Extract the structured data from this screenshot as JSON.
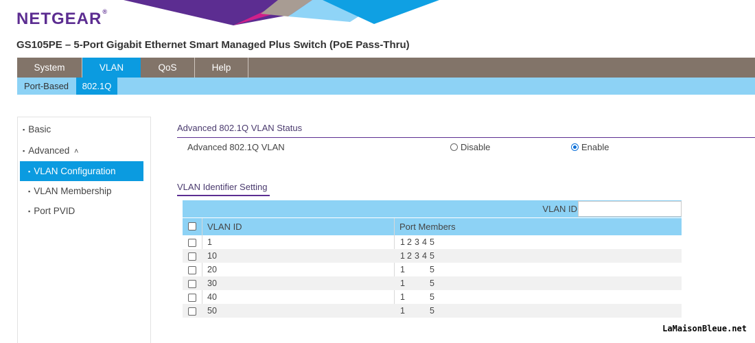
{
  "brand": {
    "logo_text": "NETGEAR",
    "logo_mark": "®"
  },
  "product_title": "GS105PE – 5-Port Gigabit Ethernet Smart Managed Plus Switch (PoE Pass-Thru)",
  "top_nav": {
    "tabs": [
      {
        "label": "System",
        "active": false
      },
      {
        "label": "VLAN",
        "active": true
      },
      {
        "label": "QoS",
        "active": false
      },
      {
        "label": "Help",
        "active": false
      }
    ]
  },
  "sub_nav": {
    "items": [
      {
        "label": "Port-Based",
        "active": false
      },
      {
        "label": "802.1Q",
        "active": true
      }
    ]
  },
  "sidebar": {
    "items": [
      {
        "label": "Basic",
        "bullet": "▪"
      },
      {
        "label": "Advanced",
        "bullet": "▪",
        "caret": "˄"
      },
      {
        "label": "VLAN Configuration",
        "bullet": "▪",
        "active": true
      },
      {
        "label": "VLAN Membership",
        "bullet": "▪"
      },
      {
        "label": "Port PVID",
        "bullet": "▪"
      }
    ]
  },
  "status_section": {
    "title": "Advanced 802.1Q VLAN Status",
    "row_label": "Advanced 802.1Q VLAN",
    "options": [
      {
        "label": "Disable",
        "checked": false
      },
      {
        "label": "Enable",
        "checked": true
      }
    ]
  },
  "identifier_section": {
    "title": "VLAN Identifier Setting",
    "vlan_id_label": "VLAN ID",
    "vlan_id_value": "",
    "columns": [
      "VLAN ID",
      "Port Members"
    ],
    "rows": [
      {
        "vlan_id": "1",
        "ports": [
          "1",
          "2",
          "3",
          "4",
          "5"
        ]
      },
      {
        "vlan_id": "10",
        "ports": [
          "1",
          "2",
          "3",
          "4",
          "5"
        ]
      },
      {
        "vlan_id": "20",
        "ports": [
          "1",
          "",
          "",
          "",
          "5"
        ]
      },
      {
        "vlan_id": "30",
        "ports": [
          "1",
          "",
          "",
          "",
          "5"
        ]
      },
      {
        "vlan_id": "40",
        "ports": [
          "1",
          "",
          "",
          "",
          "5"
        ]
      },
      {
        "vlan_id": "50",
        "ports": [
          "1",
          "",
          "",
          "",
          "5"
        ]
      }
    ]
  },
  "watermark": "LaMaisonBleue.net",
  "colors": {
    "brand_purple": "#5c2d91",
    "nav_gray": "#827469",
    "active_blue": "#0b9be0",
    "light_blue": "#8dd2f5"
  }
}
